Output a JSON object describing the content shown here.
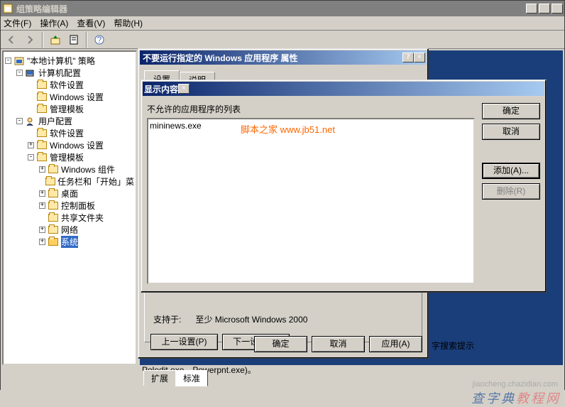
{
  "main_window": {
    "title": "组策略编辑器",
    "menu": {
      "file": "文件(F)",
      "action": "操作(A)",
      "view": "查看(V)",
      "help": "帮助(H)"
    }
  },
  "tree": {
    "root": "\"本地计算机\" 策略",
    "computer_config": "计算机配置",
    "software_settings1": "软件设置",
    "windows_settings1": "Windows 设置",
    "admin_templates1": "管理模板",
    "user_config": "用户配置",
    "software_settings2": "软件设置",
    "windows_settings2": "Windows 设置",
    "admin_templates2": "管理模板",
    "windows_components": "Windows 组件",
    "taskbar_start": "任务栏和「开始」菜",
    "desktop": "桌面",
    "control_panel": "控制面板",
    "shared_folders": "共享文件夹",
    "network": "网络",
    "system": "系统"
  },
  "tabs": {
    "extend": "扩展",
    "standard": "标准"
  },
  "prop_dialog": {
    "title": "不要运行指定的 Windows 应用程序 属性",
    "tab_setting": "设置",
    "tab_explain": "说明",
    "supported_label": "支持于:",
    "supported_value": "至少 Microsoft Windows 2000",
    "prev_setting": "上一设置(P)",
    "next_setting": "下一设置(N)",
    "ok": "确定",
    "cancel": "取消",
    "apply": "应用(A)"
  },
  "show_dialog": {
    "title": "显示内容",
    "list_label": "不允许的应用程序的列表",
    "item1": "mininews.exe",
    "ok": "确定",
    "cancel": "取消",
    "add": "添加(A)...",
    "remove": "删除(R)"
  },
  "misc": {
    "search_hint": "字搜索提示",
    "poledit": "Poledit.exe，Powerpnt.exe)。",
    "watermark_center": "脚本之家 www.jb51.net",
    "watermark_br1": "查字典",
    "watermark_br1b": "教程网",
    "watermark_br2": "jiaocheng.chazidian.com"
  }
}
